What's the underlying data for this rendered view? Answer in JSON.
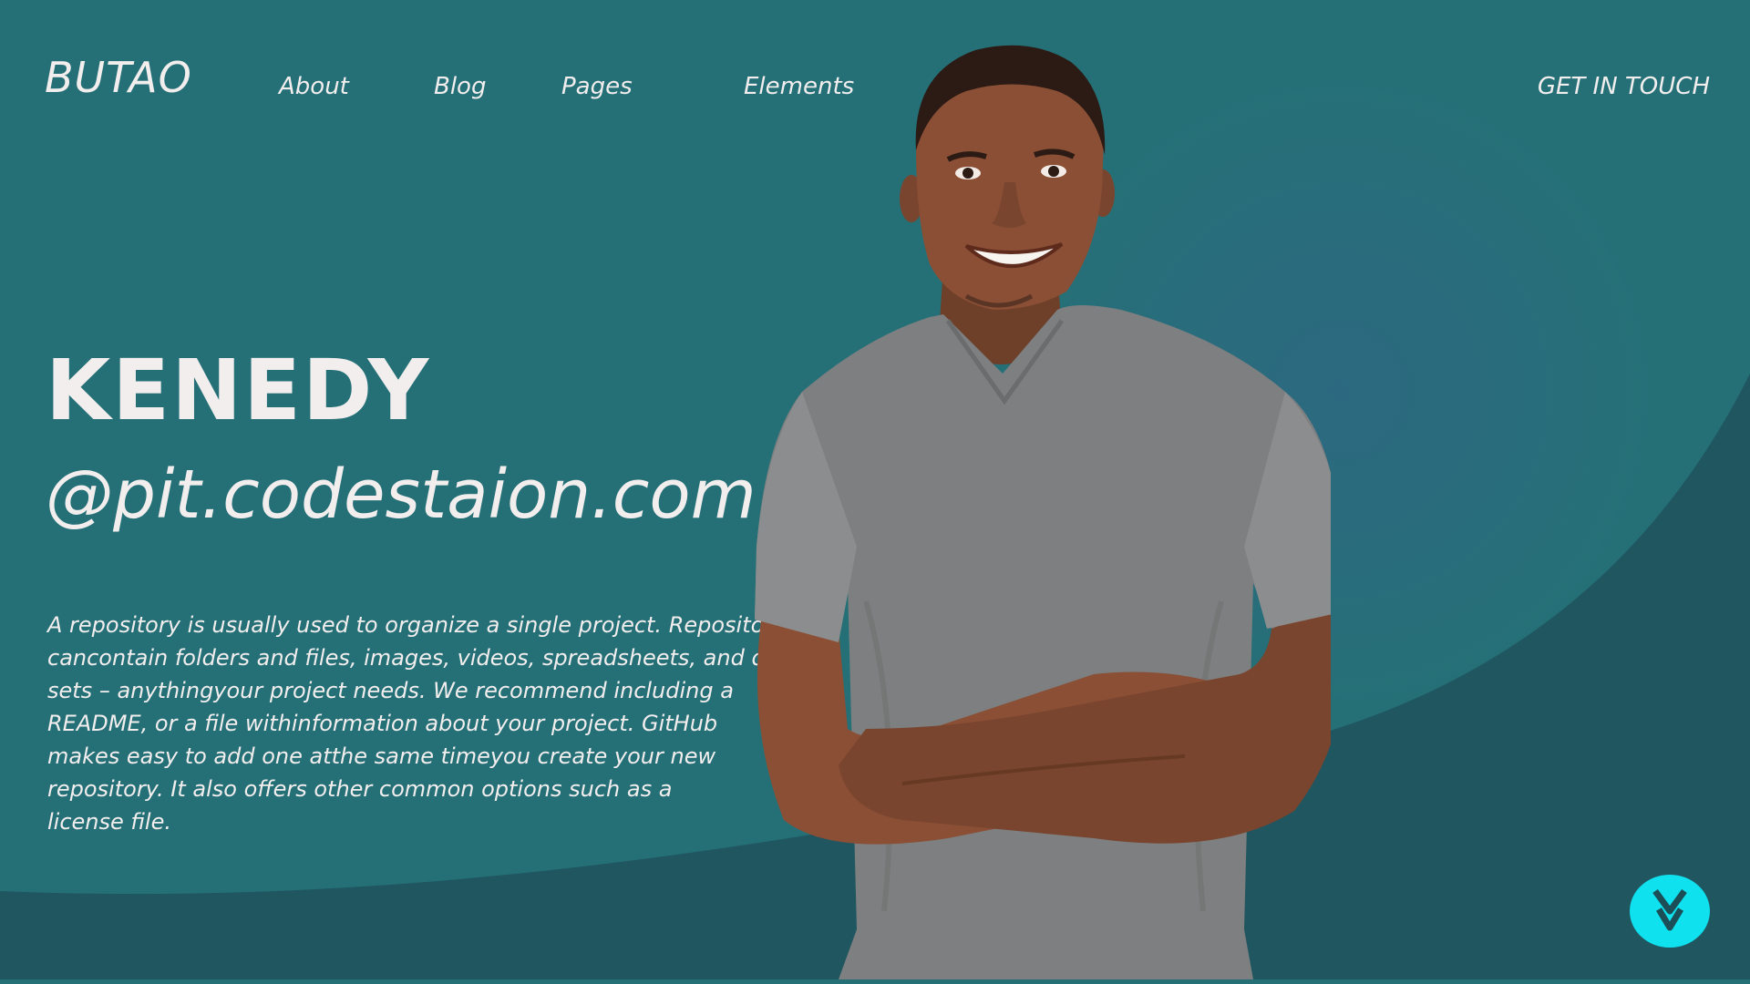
{
  "brand": {
    "logo": "BUTAO"
  },
  "nav": {
    "items": [
      {
        "label": "About"
      },
      {
        "label": "Blog"
      },
      {
        "label": "Pages"
      },
      {
        "label": "Elements"
      }
    ],
    "cta_label": "GET IN TOUCH"
  },
  "hero": {
    "name": "KENEDY",
    "handle": "@pit.codestaion.com",
    "description_lines": [
      "A repository is usually used to organize a single project. Repositories",
      " cancontain folders and files, images, videos, spreadsheets, and data",
      "sets – anythingyour project needs. We recommend including a",
      "README, or a file withinformation about your project. GitHub",
      " makes easy to add one atthe same timeyou create your new",
      "repository. It also offers other common options such as a",
      "license file."
    ]
  },
  "icons": {
    "scroll": "double-chevron-down-icon",
    "photo": "person-portrait"
  },
  "colors": {
    "background": "#257077",
    "wave": "#205660",
    "text": "#f2eeee",
    "accent": "#10e1ef"
  }
}
